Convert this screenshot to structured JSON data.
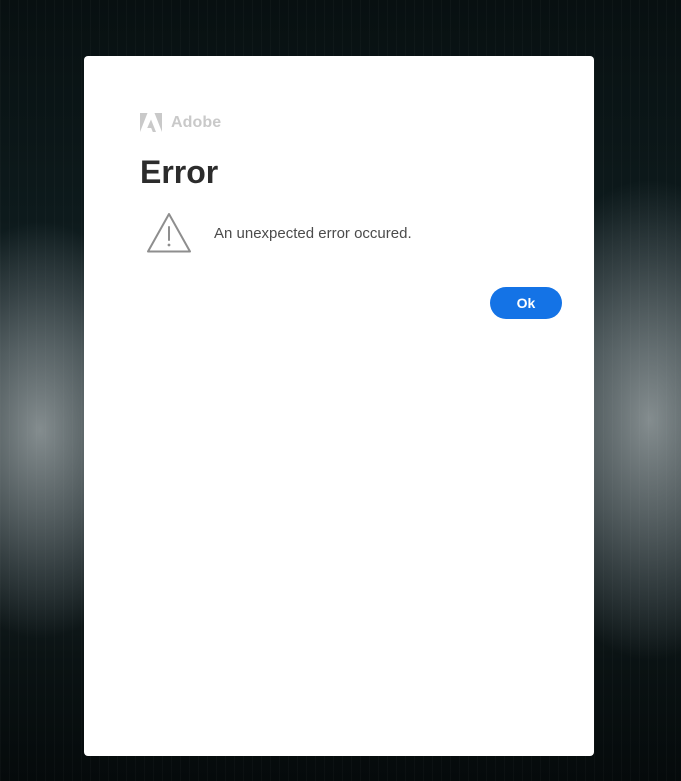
{
  "brand": {
    "name": "Adobe",
    "logo_icon": "adobe-logo-icon"
  },
  "dialog": {
    "title": "Error",
    "icon": "warning-triangle-icon",
    "message": "An unexpected error occured.",
    "ok_label": "Ok"
  },
  "colors": {
    "primary_button": "#1473e6",
    "title_text": "#2c2c2c",
    "brand_text": "#c9c9c9"
  }
}
